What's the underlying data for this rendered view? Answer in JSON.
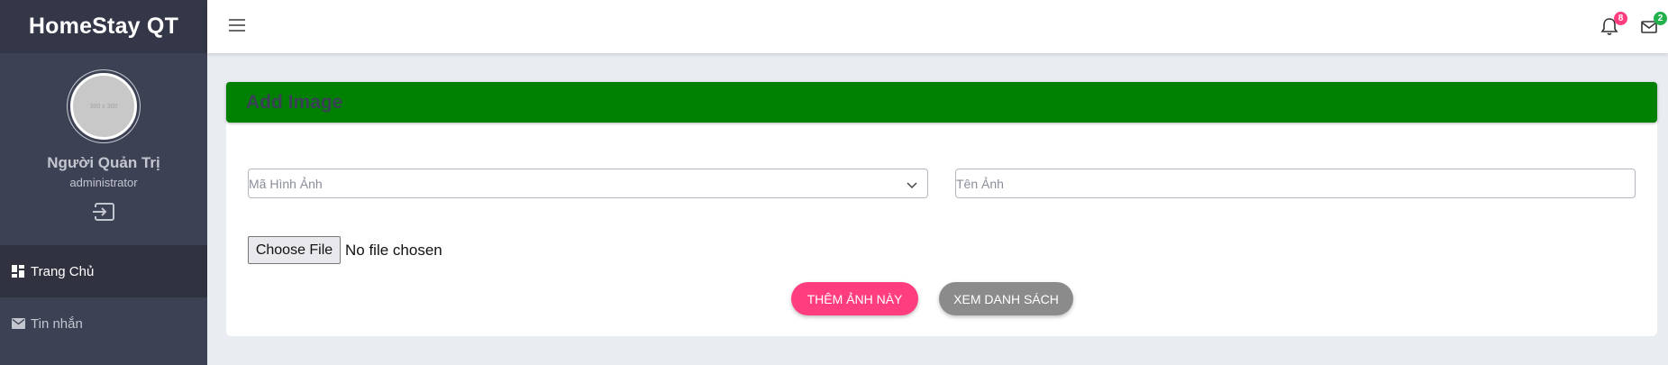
{
  "app": {
    "brand": "HomeStay QT"
  },
  "sidebar": {
    "avatar_placeholder": "300 x 300",
    "user_name": "Người Quản Trị",
    "user_role": "administrator",
    "items": [
      {
        "label": "Trang Chủ",
        "icon": "dashboard-icon",
        "active": true
      },
      {
        "label": "Tin nhắn",
        "icon": "mail-icon",
        "active": false
      }
    ]
  },
  "topbar": {
    "notifications_count": "8",
    "messages_count": "2",
    "colors": {
      "notification_badge": "#ff3d7f",
      "message_badge": "#22b14c"
    }
  },
  "form": {
    "title": "Add Image",
    "image_code_placeholder": "Mã Hình Ảnh",
    "image_name_placeholder": "Tên Ảnh",
    "file_button_label": "Choose File",
    "file_status": "No file chosen",
    "submit_label": "THÊM ẢNH NÀY",
    "list_label": "XEM DANH SÁCH"
  },
  "colors": {
    "sidebar_bg": "#3d4154",
    "brand_bg": "#343747",
    "header_green": "#008000",
    "submit_pink": "#ff3d7f",
    "list_gray": "#8b8b8b",
    "page_bg": "#e9ecf1"
  }
}
